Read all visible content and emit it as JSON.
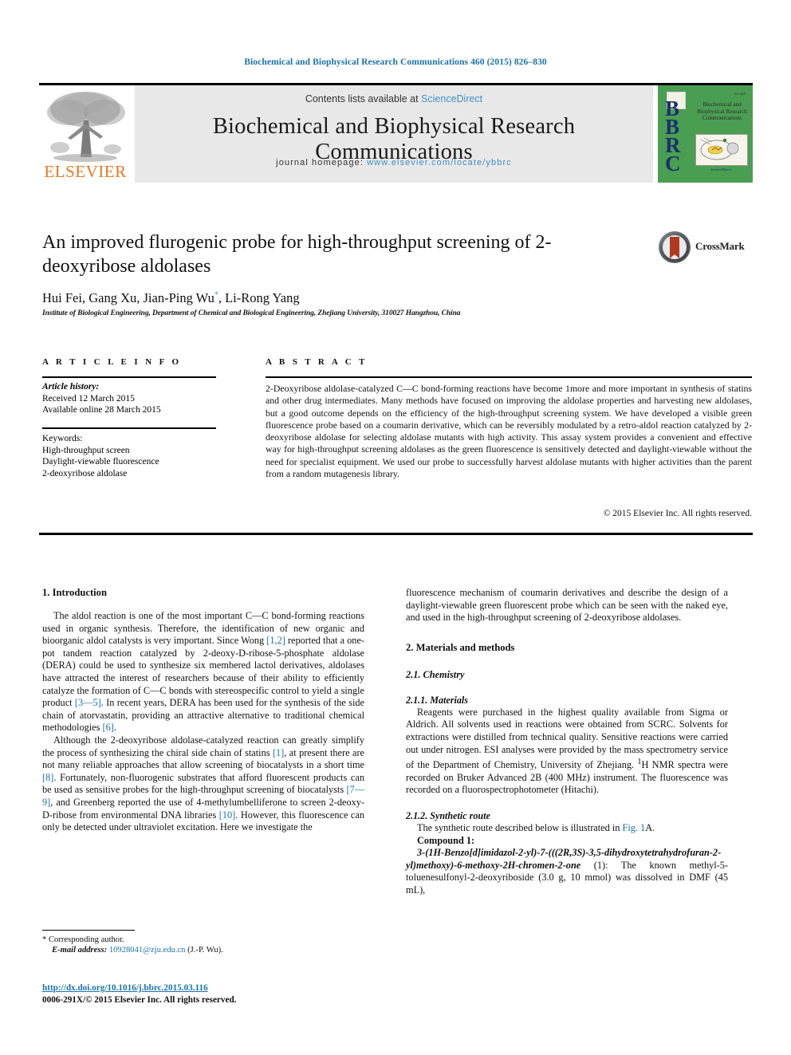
{
  "running_head": "Biochemical and Biophysical Research Communications 460 (2015) 826–830",
  "masthead": {
    "contents_prefix": "Contents lists available at ",
    "sciencedirect": "ScienceDirect",
    "journal_title": "Biochemical and Biophysical Research Communications",
    "homepage_label": "journal homepage: ",
    "homepage_url": "www.elsevier.com/locate/ybbrc",
    "publisher_logo_text": "ELSEVIER",
    "cover": {
      "bbrc": "BBRC",
      "title_lines": "Biochemical and Biophysical Research Communications",
      "volume": "Vol 460",
      "footer": "ScienceDirect"
    }
  },
  "crossmark": {
    "label": "CrossMark"
  },
  "article": {
    "title": "An improved flurogenic probe for high-throughput screening of 2-deoxyribose aldolases",
    "authors": "Hui Fei, Gang Xu, Jian-Ping Wu",
    "authors_tail": ", Li-Rong Yang",
    "corresponding_marker": "*",
    "affiliation": "Institute of Biological Engineering, Department of Chemical and Biological Engineering, Zhejiang University, 310027 Hangzhou, China"
  },
  "article_info": {
    "heading": "A R T I C L E   I N F O",
    "history_label": "Article history:",
    "received": "Received 12 March 2015",
    "available": "Available online 28 March 2015",
    "keywords_label": "Keywords:",
    "keywords": [
      "High-throughput screen",
      "Daylight-viewable fluorescence",
      "2-deoxyribose aldolase"
    ]
  },
  "abstract": {
    "heading": "A B S T R A C T",
    "text": "2-Deoxyribose aldolase-catalyzed C—C bond-forming reactions have become 1more and more important in synthesis of statins and other drug intermediates. Many methods have focused on improving the aldolase properties and harvesting new aldolases, but a good outcome depends on the efficiency of the high-throughput screening system. We have developed a visible green fluorescence probe based on a coumarin derivative, which can be reversibly modulated by a retro-aldol reaction catalyzed by 2-deoxyribose aldolase for selecting aldolase mutants with high activity. This assay system provides a convenient and effective way for high-throughput screening aldolases as the green fluorescence is sensitively detected and daylight-viewable without the need for specialist equipment. We used our probe to successfully harvest aldolase mutants with higher activities than the parent from a random mutagenesis library.",
    "copyright": "© 2015 Elsevier Inc. All rights reserved."
  },
  "body": {
    "intro_heading": "1.  Introduction",
    "intro_p1_a": "The aldol reaction is one of the most important C—C bond-forming reactions used in organic synthesis. Therefore, the identification of new organic and bioorganic aldol catalysts is very important. Since Wong ",
    "intro_p1_ref1": "[1,2]",
    "intro_p1_b": " reported that a one-pot tandem reaction catalyzed by 2-deoxy-D-ribose-5-phosphate aldolase (DERA) could be used to synthesize six membered lactol derivatives, aldolases have attracted the interest of researchers because of their ability to efficiently catalyze the formation of C—C bonds with stereospecific control to yield a single product ",
    "intro_p1_ref2": "[3—5]",
    "intro_p1_c": ". In recent years, DERA has been used for the synthesis of the side chain of atorvastatin, providing an attractive alternative to traditional chemical methodologies ",
    "intro_p1_ref3": "[6]",
    "intro_p1_d": ".",
    "intro_p2_a": "Although the 2-deoxyribose aldolase-catalyzed reaction can greatly simplify the process of synthesizing the chiral side chain of statins ",
    "intro_p2_ref1": "[1]",
    "intro_p2_b": ", at present there are not many reliable approaches that allow screening of biocatalysts in a short time ",
    "intro_p2_ref2": "[8]",
    "intro_p2_c": ". Fortunately, non-fluorogenic substrates that afford fluorescent products can be used as sensitive probes for the high-throughput screening of biocatalysts ",
    "intro_p2_ref3": "[7—9]",
    "intro_p2_d": ", and Greenberg reported the use of 4-methylumbelliferone to screen 2-deoxy-D-ribose from environmental DNA libraries ",
    "intro_p2_ref4": "[10]",
    "intro_p2_e": ". However, this fluorescence can only be detected under ultraviolet excitation. Here we investigate the",
    "right_p1": "fluorescence mechanism of coumarin derivatives and describe the design of a daylight-viewable green fluorescent probe which can be seen with the naked eye, and used in the high-throughput screening of 2-deoxyribose aldolases.",
    "methods_heading": "2.  Materials and methods",
    "chemistry_heading": "2.1.  Chemistry",
    "materials_heading": "2.1.1.  Materials",
    "materials_p_a": "Reagents were purchased in the highest quality available from Sigma or Aldrich. All solvents used in reactions were obtained from SCRC. Solvents for extractions were distilled from technical quality. Sensitive reactions were carried out under nitrogen. ESI analyses were provided by the mass spectrometry service of the Department of Chemistry, University of Zhejiang. ",
    "materials_p_sup": "1",
    "materials_p_b": "H NMR spectra were recorded on Bruker Advanced 2B (400 MHz) instrument. The fluorescence was recorded on a fluorospectrophotometer (Hitachi).",
    "route_heading": "2.1.2.  Synthetic route",
    "route_p_a": "The synthetic route described below is illustrated in ",
    "route_fig_link": "Fig. 1",
    "route_p_b": "A.",
    "compound_label": "Compound 1:",
    "compound_name": "3-(1H-Benzo[d]imidazol-2-yl)-7-(((2R,3S)-3,5-dihydroxytetrahydrofuran-2-yl)methoxy)-6-methoxy-2H-chromen-2-one",
    "compound_tail": " (1): The known methyl-5-toluenesulfonyl-2-deoxyriboside (3.0 g, 10 mmol) was dissolved in DMF (45 mL),"
  },
  "footnotes": {
    "corresponding": "Corresponding author.",
    "email_label": "E-mail address:",
    "email": "10928041@zju.edu.cn",
    "email_tail": " (J.-P. Wu).",
    "doi": "http://dx.doi.org/10.1016/j.bbrc.2015.03.116",
    "issn_line": "0006-291X/© 2015 Elsevier Inc. All rights reserved."
  },
  "colors": {
    "link_blue": "#1a72a8",
    "elsevier_orange": "#e87722",
    "cover_green": "#4a9e52"
  }
}
